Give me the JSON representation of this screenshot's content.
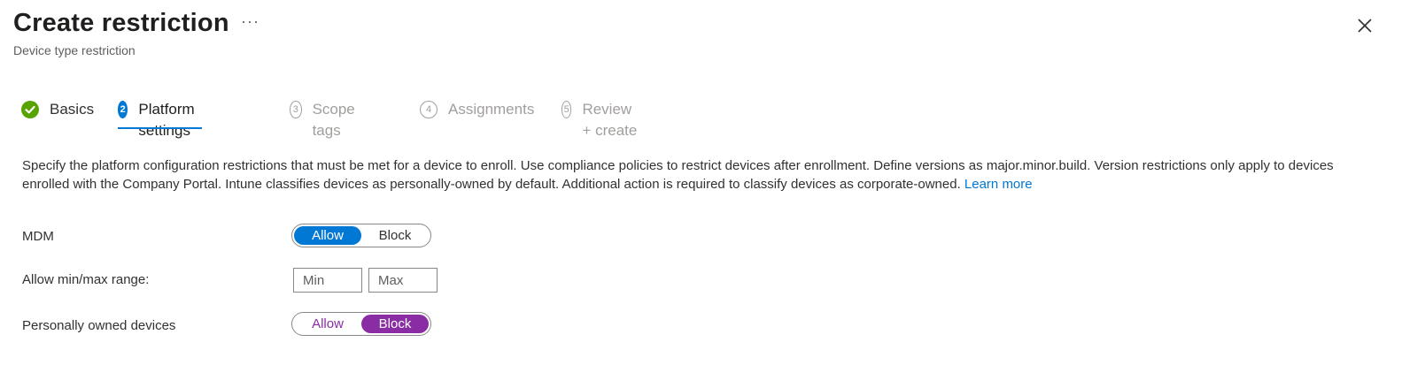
{
  "header": {
    "title": "Create restriction",
    "more_label": "···",
    "subtitle": "Device type restriction",
    "close_icon": "close-icon"
  },
  "steps": [
    {
      "number": "",
      "label": "Basics",
      "state": "completed"
    },
    {
      "number": "2",
      "label": "Platform settings",
      "state": "active"
    },
    {
      "number": "3",
      "label": "Scope tags",
      "state": "pending"
    },
    {
      "number": "4",
      "label": "Assignments",
      "state": "pending"
    },
    {
      "number": "5",
      "label": "Review + create",
      "state": "pending"
    }
  ],
  "description": {
    "text": "Specify the platform configuration restrictions that must be met for a device to enroll. Use compliance policies to restrict devices after enrollment. Define versions as major.minor.build. Version restrictions only apply to devices enrolled with the Company Portal. Intune classifies devices as personally-owned by default. Additional action is required to classify devices as corporate-owned.",
    "link": "Learn more"
  },
  "settings": {
    "mdm": {
      "label": "MDM",
      "options": [
        "Allow",
        "Block"
      ],
      "selected": "Allow"
    },
    "range": {
      "label": "Allow min/max range:",
      "min_placeholder": "Min",
      "max_placeholder": "Max",
      "min_value": "",
      "max_value": ""
    },
    "personal": {
      "label": "Personally owned devices",
      "options": [
        "Allow",
        "Block"
      ],
      "selected": "Block"
    }
  },
  "colors": {
    "accent": "#0078d4",
    "completed": "#57a300",
    "block_selected": "#8a2da5"
  }
}
